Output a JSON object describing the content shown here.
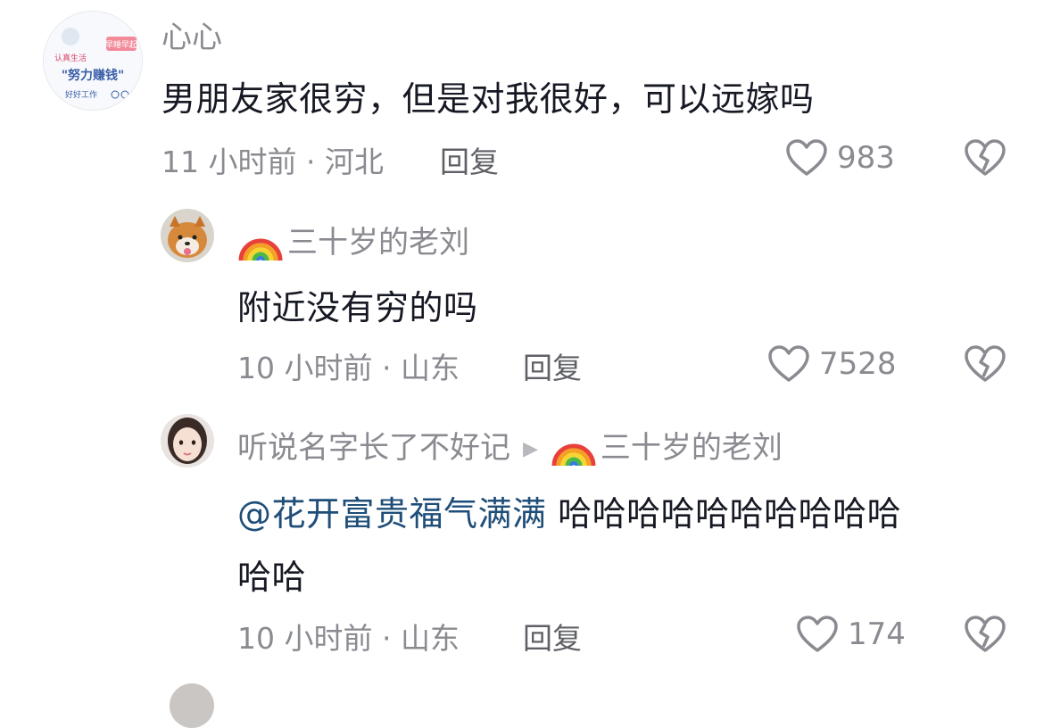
{
  "comments": [
    {
      "user": "心心",
      "avatar_text": {
        "line1": "认真生活",
        "line2": "\"努力赚钱\"",
        "line3": "好好工作",
        "badge": "早睡早起"
      },
      "text": "男朋友家很穷，但是对我很好，可以远嫁吗",
      "time_location": "11 小时前 · 河北",
      "reply_label": "回复",
      "likes": "983"
    },
    {
      "user": "三十岁的老刘",
      "user_emoji": "rainbow",
      "text": "附近没有穷的吗",
      "time_location": "10 小时前 · 山东",
      "reply_label": "回复",
      "likes": "7528"
    },
    {
      "user": "听说名字长了不好记",
      "reply_to": "三十岁的老刘",
      "reply_to_emoji": "rainbow",
      "mention": "@花开富贵福气满满",
      "text_line1": " 哈哈哈哈哈哈哈哈哈哈",
      "text_line2": "哈哈",
      "time_location": "10 小时前 · 山东",
      "reply_label": "回复",
      "likes": "174"
    }
  ],
  "icons": {
    "like": "heart-outline-icon",
    "dislike": "broken-heart-icon",
    "reply_arrow": "triangle-right-icon"
  },
  "colors": {
    "text": "#161823",
    "secondary": "#8a8b91",
    "mention": "#1f4e79"
  }
}
